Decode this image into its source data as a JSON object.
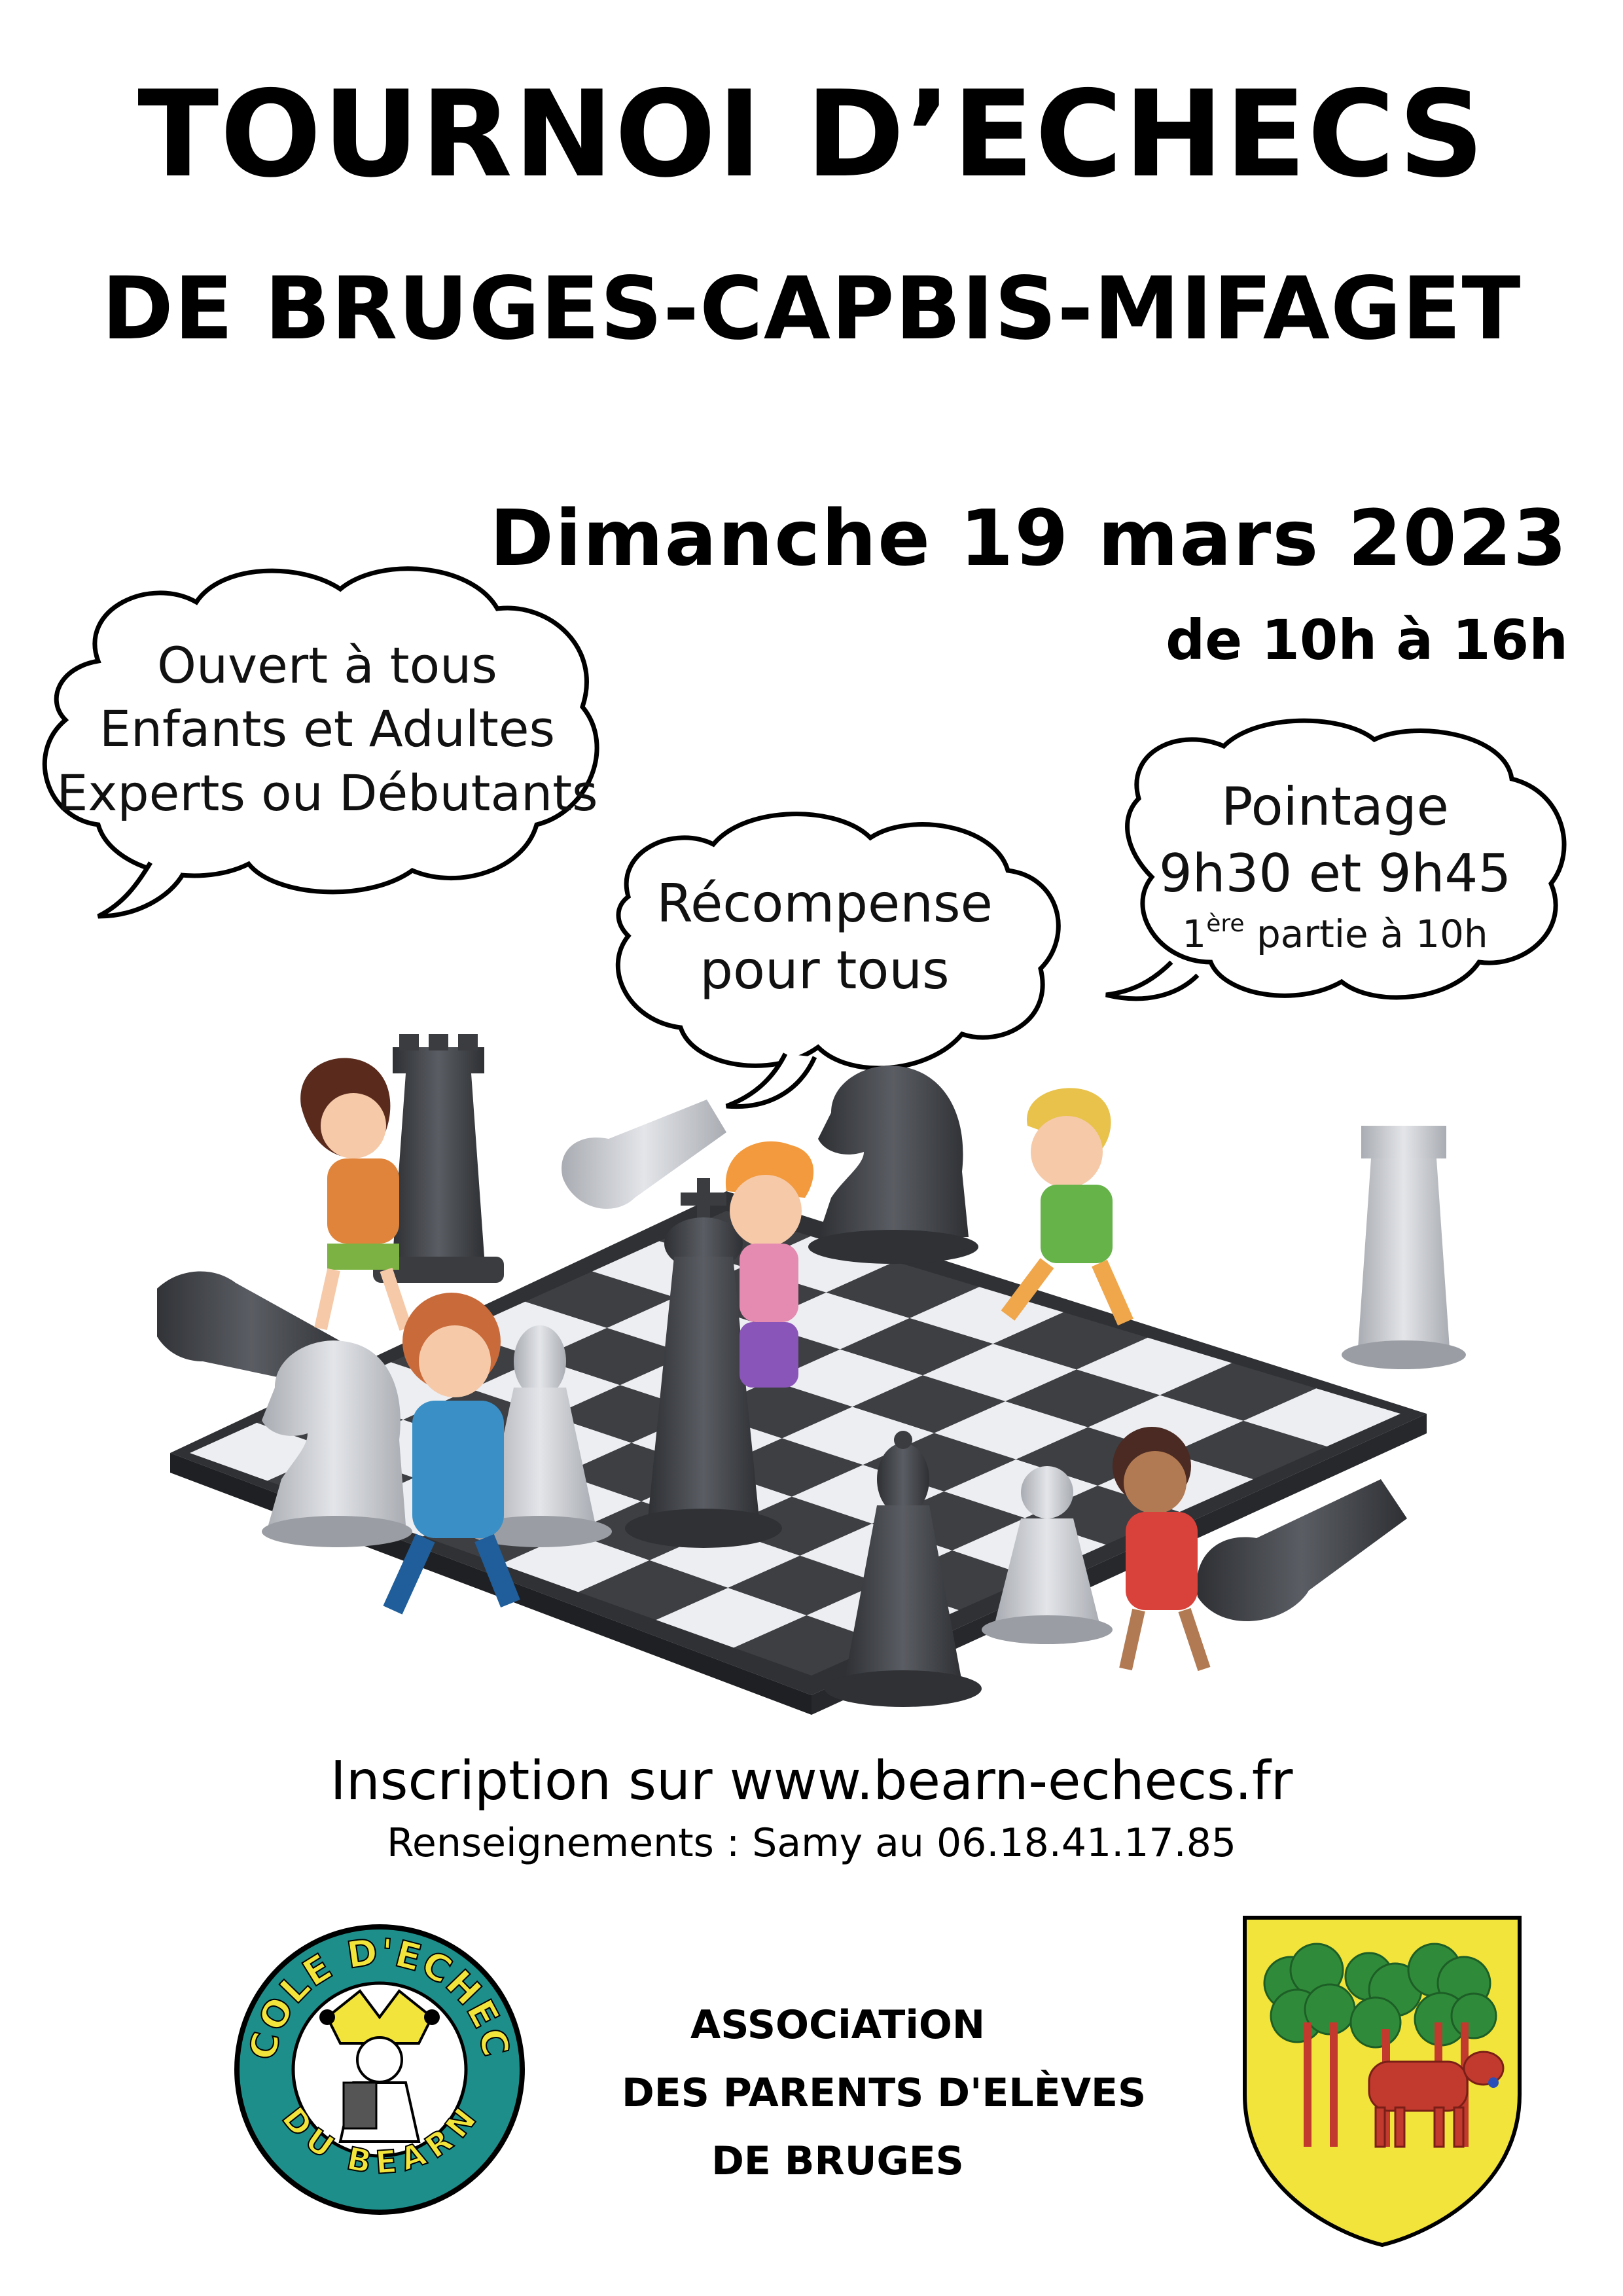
{
  "header": {
    "title": "TOURNOI D’ECHECS",
    "subtitle": "DE BRUGES-CAPBIS-MIFAGET"
  },
  "event": {
    "date": "Dimanche 19 mars 2023",
    "hours": "de 10h à 16h"
  },
  "bubbles": {
    "open": {
      "line1": "Ouvert à tous",
      "line2": "Enfants et Adultes",
      "line3": "Experts ou Débutants"
    },
    "reward": {
      "line1": "Récompense",
      "line2": "pour tous"
    },
    "checkin": {
      "line1": "Pointage",
      "line2": "9h30 et 9h45",
      "first_num": "1",
      "first_sup": "ère",
      "first_rest": " partie à 10h"
    }
  },
  "footer": {
    "registration": "Inscription sur www.bearn-echecs.fr",
    "info": "Renseignements : Samy au 06.18.41.17.85"
  },
  "logos": {
    "school_top": "ECOLE D'ECHECS",
    "school_bottom": "DU BEARN",
    "association_line1": "ASSOCiATiON",
    "association_line2": "DES PARENTS D'ELÈVES",
    "association_line3": "DE BRUGES"
  },
  "colors": {
    "school_ring": "#1e8e8a",
    "crest_gold": "#f2e43a",
    "crest_tree": "#2f8b3a",
    "crest_cow": "#c23a2e",
    "board_dark": "#3d3f43",
    "board_light": "#eceef2"
  }
}
